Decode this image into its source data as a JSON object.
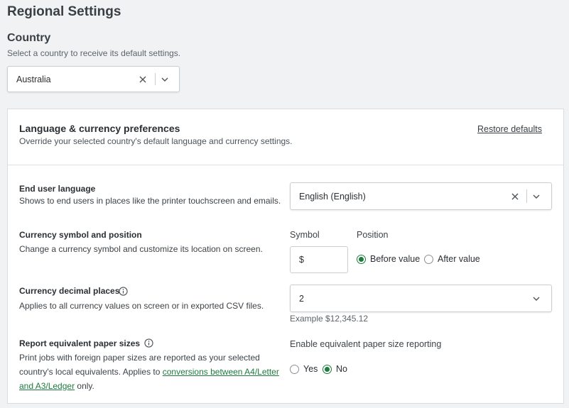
{
  "page": {
    "title": "Regional Settings"
  },
  "country": {
    "title": "Country",
    "subtitle": "Select a country to receive its default settings.",
    "selected": "Australia"
  },
  "card": {
    "title": "Language & currency preferences",
    "subtitle": "Override your selected country's default language and currency settings.",
    "restore_label": "Restore defaults"
  },
  "language": {
    "title": "End user language",
    "desc": "Shows to end users in places like the printer touchscreen and emails.",
    "selected": "English (English)"
  },
  "currency": {
    "title": "Currency symbol and position",
    "desc": "Change a currency symbol and customize its location on screen.",
    "symbol_label": "Symbol",
    "symbol_value": "$",
    "position_label": "Position",
    "before_label": "Before value",
    "after_label": "After value",
    "position_selected": "before"
  },
  "decimals": {
    "title": "Currency decimal places",
    "desc": "Applies to all currency values on screen or in exported CSV files.",
    "selected": "2",
    "example": "Example $12,345.12"
  },
  "paper": {
    "title": "Report equivalent paper sizes",
    "desc_line1": "Print jobs with foreign paper sizes are reported as your selected",
    "desc_line2_prefix": "country's local equivalents. Applies to ",
    "link_part1": "conversions between A4/Letter",
    "link_part2": "and A3/Ledger",
    "desc_suffix": " only.",
    "enable_label": "Enable equivalent paper size reporting",
    "yes_label": "Yes",
    "no_label": "No",
    "selected": "no"
  },
  "colors": {
    "accent": "#1e7a3d",
    "background": "#f0f2f4",
    "border": "#c9ced3"
  }
}
